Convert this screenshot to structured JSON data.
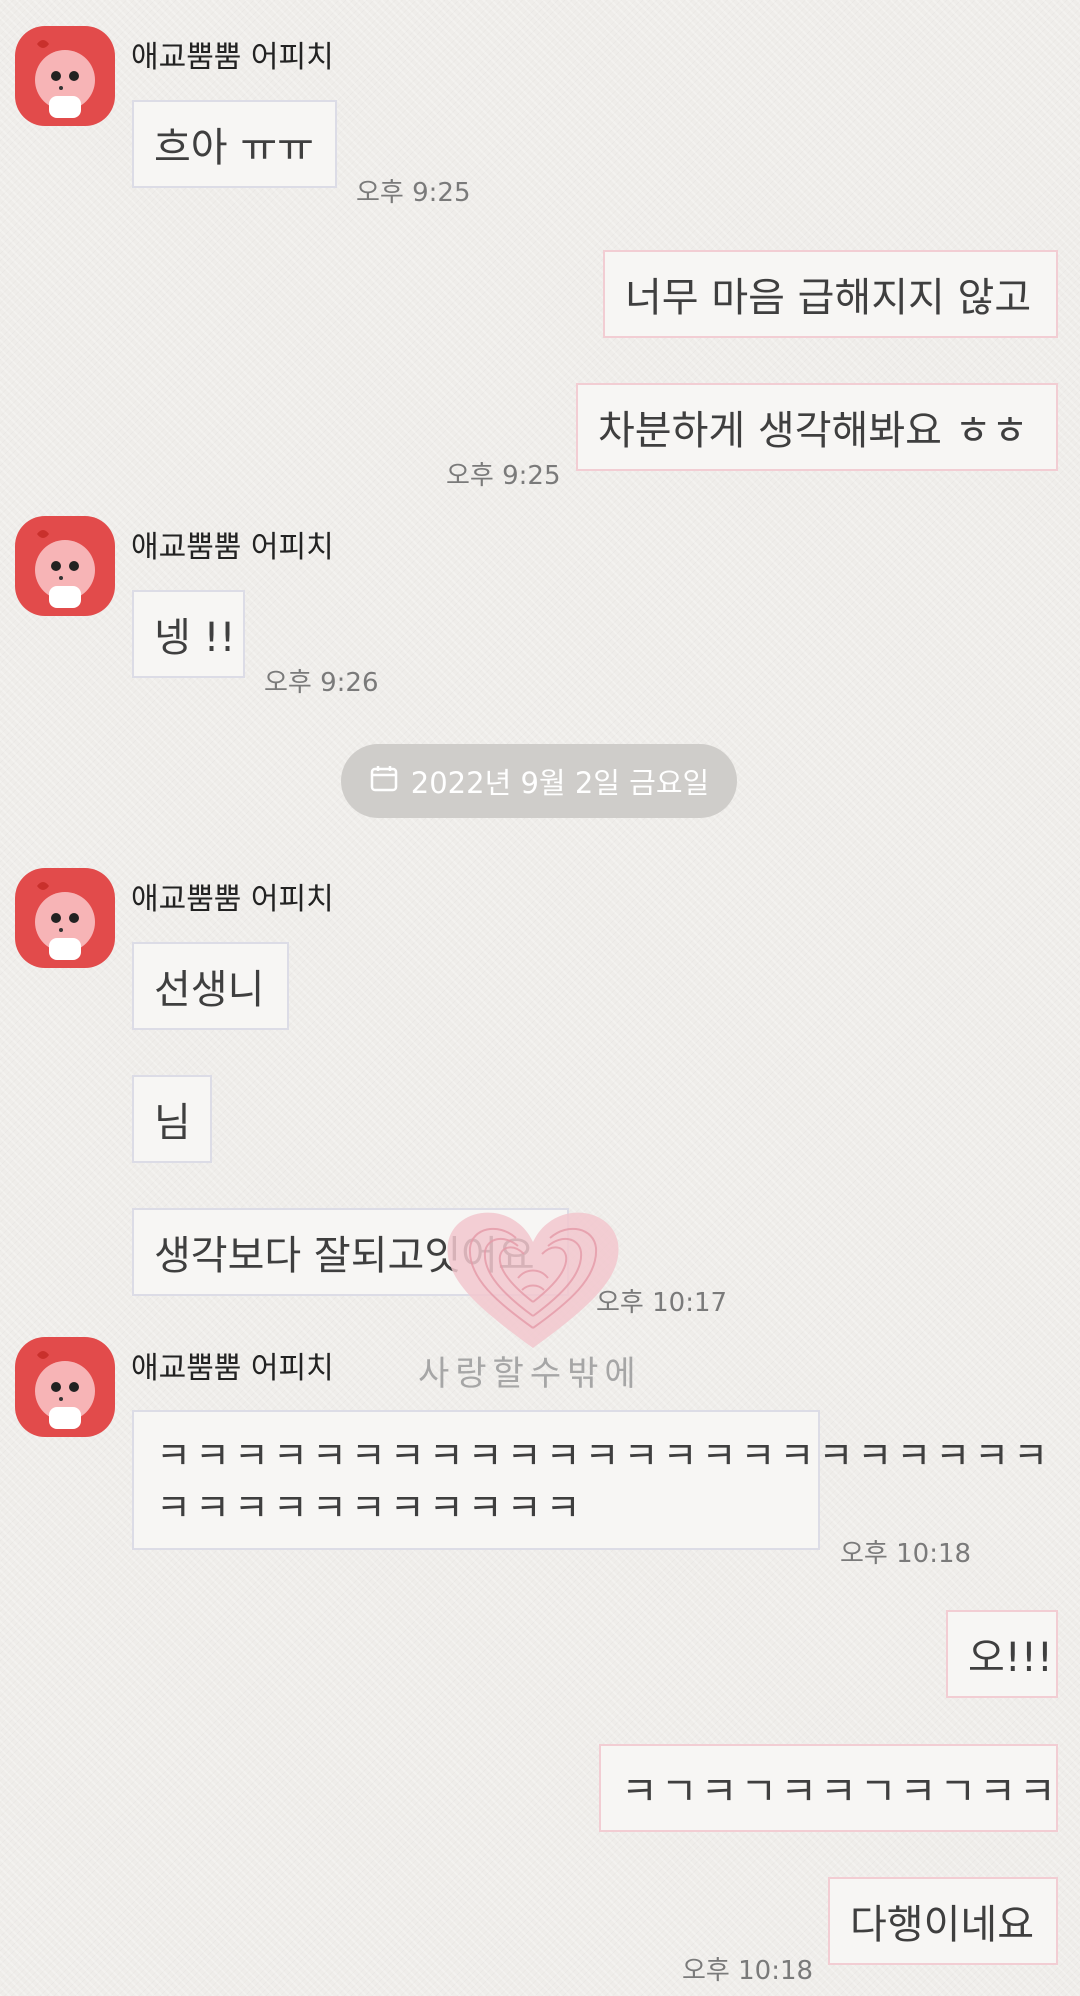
{
  "chat": {
    "sender_name": "애교뿜뿜 어피치",
    "messages": [
      {
        "side": "left",
        "text": "흐아 ㅠㅠ",
        "time": "오후 9:25"
      },
      {
        "side": "right",
        "text": "너무 마음 급해지지 않고"
      },
      {
        "side": "right",
        "text": "차분하게 생각해봐요 ㅎㅎ",
        "time": "오후 9:25"
      },
      {
        "side": "left",
        "text": "넹 !!",
        "time": "오후 9:26"
      },
      {
        "side": "left",
        "text": "선생니"
      },
      {
        "side": "left",
        "text": "님"
      },
      {
        "side": "left",
        "text": "생각보다 잘되고잇어요",
        "time": "오후 10:17"
      },
      {
        "side": "left",
        "text_line1": "ㅋㅋㅋㅋㅋㅋㅋㅋㅋㅋㅋㅋㅋㅋㅋㅋㅋㅋㅋㅋㅋㅋㅋ",
        "text_line2": "ㅋㅋㅋㅋㅋㅋㅋㅋㅋㅋㅋ",
        "time": "오후 10:18"
      },
      {
        "side": "right",
        "text": "오!!!"
      },
      {
        "side": "right",
        "text": "ㅋㄱㅋㄱㅋㅋㄱㅋㄱㅋㅋ"
      },
      {
        "side": "right",
        "text": "다행이네요",
        "time": "오후 10:18"
      }
    ],
    "date_divider": "2022년 9월 2일 금요일",
    "watermark_text": "사랑할수밖에"
  },
  "colors": {
    "background": "#efedea",
    "avatar_bg": "#e24b4b",
    "right_bubble_border": "#f2cdd3",
    "left_bubble_border": "#dcdce6"
  },
  "icons": {
    "date": "calendar-icon",
    "watermark": "fingerprint-heart-icon"
  }
}
